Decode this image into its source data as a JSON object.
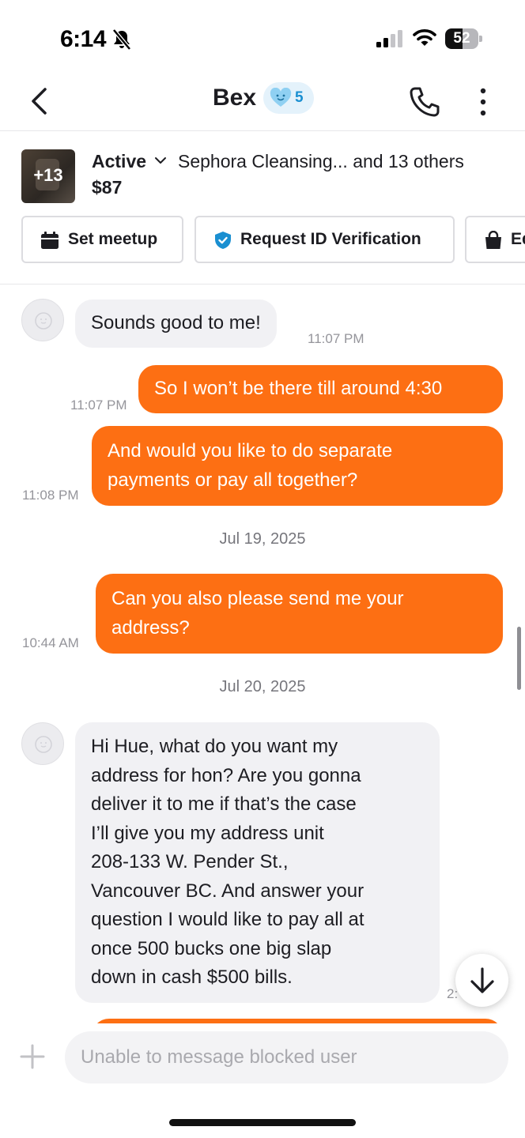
{
  "status_bar": {
    "time": "6:14",
    "battery": "52",
    "battery_level": 0.52,
    "icons": [
      "bell-slash-icon",
      "signal-icon",
      "wifi-icon",
      "battery-icon"
    ]
  },
  "header": {
    "title": "Bex",
    "badge_count": "5",
    "icons": [
      "back-chevron-icon",
      "heart-badge-icon",
      "phone-icon",
      "more-vertical-icon"
    ]
  },
  "listing": {
    "thumb_label": "+13",
    "status": "Active",
    "items": "Sephora Cleansing... and 13 others",
    "price": "$87",
    "actions": {
      "meetup": "Set meetup",
      "verify": "Request ID Verification",
      "edit": "Ed"
    }
  },
  "conversation": {
    "messages": [
      {
        "from": "them",
        "text": "Sounds good to me!",
        "time": "11:07 PM"
      },
      {
        "from": "me",
        "text": "So I won’t be there till around 4:30",
        "time": "11:07 PM"
      },
      {
        "from": "me",
        "lines": [
          "And would you like to do separate",
          "payments or pay all together?"
        ],
        "time": "11:08 PM"
      },
      {
        "date": "Jul 19, 2025"
      },
      {
        "from": "me",
        "lines": [
          "Can you also please send me your",
          "address?"
        ],
        "time": "10:44 AM"
      },
      {
        "date": "Jul 20, 2025"
      },
      {
        "from": "them",
        "lines": [
          "Hi Hue, what do you want my",
          "address for hon? Are you gonna",
          "deliver it to me if that’s the case",
          "I’ll give you my address unit",
          "208-133 W. Pender St.,",
          "Vancouver BC. And answer your",
          "question I would like to pay all at",
          "once 500 bucks one big slap",
          "down in cash $500 bills."
        ],
        "time": "2:"
      }
    ]
  },
  "composer": {
    "placeholder": "Unable to message blocked user"
  },
  "colors": {
    "accent": "#fd6f13",
    "incoming_bubble": "#f1f1f4",
    "verify_badge": "#1a8fd1"
  }
}
